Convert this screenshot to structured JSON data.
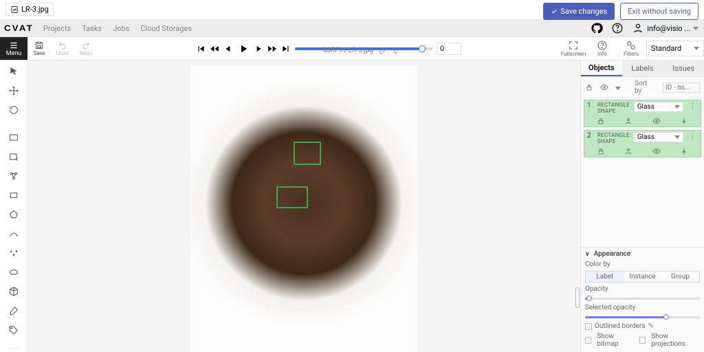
{
  "file": {
    "name": "LR-3.jpg"
  },
  "actions": {
    "save_changes": "Save changes",
    "exit_without_saving": "Exit without saving"
  },
  "logo": "CVAT",
  "nav": {
    "projects": "Projects",
    "tasks": "Tasks",
    "jobs": "Jobs",
    "cloud": "Cloud Storages"
  },
  "user": {
    "label": "info@visio ..."
  },
  "toolbar": {
    "menu": "Menu",
    "save": "Save",
    "undo": "Undo",
    "redo": "Redo"
  },
  "player": {
    "filename_caption": "83RF99-LR-3.jpg",
    "frame_value": "0"
  },
  "controls": {
    "fullscreen": "Fullscreen",
    "info": "Info",
    "filters": "Filters",
    "mode": "Standard"
  },
  "side_tabs": {
    "objects": "Objects",
    "labels": "Labels",
    "issues": "Issues"
  },
  "sort": {
    "label": "Sort by",
    "value": "ID - as..."
  },
  "objects": [
    {
      "id": "1",
      "kind": "RECTANGLE SHAPE",
      "label": "Glass"
    },
    {
      "id": "2",
      "kind": "RECTANGLE SHAPE",
      "label": "Glass"
    }
  ],
  "appearance": {
    "title": "Appearance",
    "color_by_label": "Color by",
    "seg_label": "Label",
    "seg_instance": "Instance",
    "seg_group": "Group",
    "opacity_label": "Opacity",
    "sel_opacity_label": "Selected opacity",
    "outlined": "Outlined borders",
    "show_bitmap": "Show bitmap",
    "show_proj": "Show projections"
  }
}
